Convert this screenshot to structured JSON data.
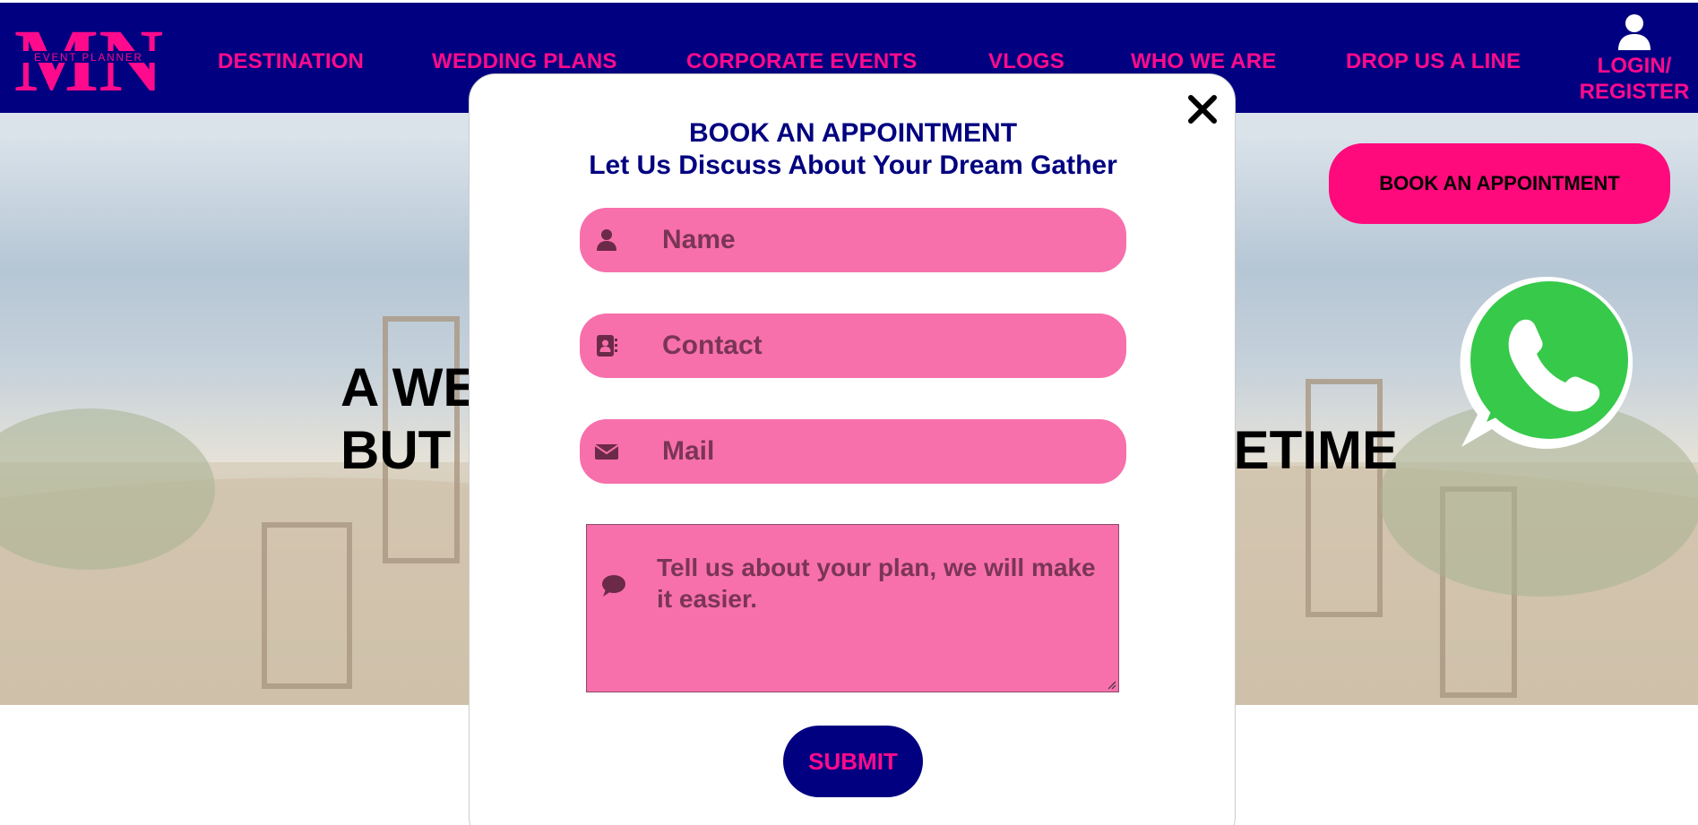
{
  "header": {
    "logo": {
      "letters": "MN",
      "tagline": "EVENT PLANNER"
    },
    "nav": [
      {
        "label": "DESTINATION"
      },
      {
        "label": "WEDDING PLANS"
      },
      {
        "label": "CORPORATE EVENTS"
      },
      {
        "label": "VLOGS"
      },
      {
        "label": "WHO WE ARE"
      },
      {
        "label": "DROP US A LINE"
      }
    ],
    "login_label_line1": "LOGIN/",
    "login_label_line2": "REGISTER",
    "login_icon": "user-icon"
  },
  "hero": {
    "line1_left": "A WE",
    "line2_left": "BUT",
    "line2_right": "ETIME",
    "book_button_label": "BOOK AN APPOINTMENT",
    "whatsapp_icon": "whatsapp-icon"
  },
  "modal": {
    "title": "BOOK AN APPOINTMENT",
    "subtitle": "Let Us Discuss About Your Dream Gather",
    "fields": {
      "name": {
        "placeholder": "Name",
        "icon": "user-icon"
      },
      "contact": {
        "placeholder": "Contact",
        "icon": "address-book-icon"
      },
      "mail": {
        "placeholder": "Mail",
        "icon": "envelope-icon"
      },
      "plan": {
        "placeholder": "Tell us about your plan, we will make it easier.",
        "icon": "comment-icon"
      }
    },
    "submit_label": "SUBMIT",
    "close_icon": "close-icon"
  },
  "colors": {
    "header_bg": "#000080",
    "accent_pink": "#ff0a8c",
    "field_pink": "#f770ab",
    "navy_text": "#000080"
  }
}
